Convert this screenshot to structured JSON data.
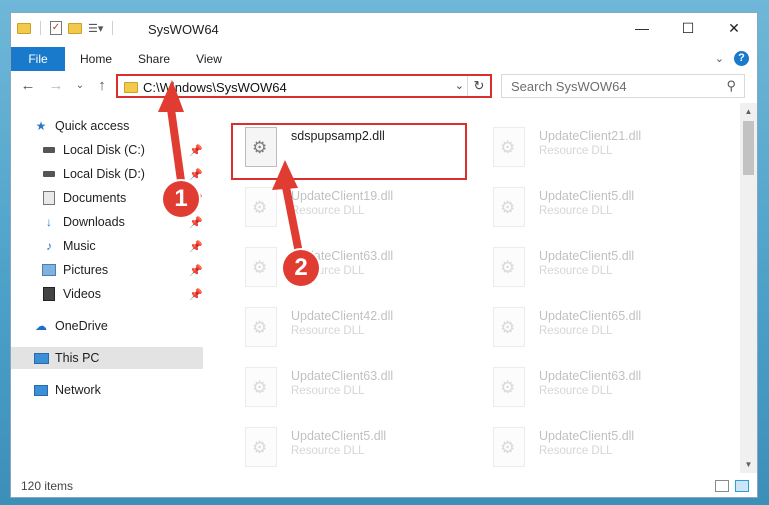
{
  "window": {
    "title": "SysWOW64",
    "controls": {
      "minimize": "—",
      "maximize": "☐",
      "close": "✕"
    }
  },
  "ribbon": {
    "tabs": [
      "File",
      "Home",
      "Share",
      "View"
    ],
    "help_glyph": "?"
  },
  "navigation": {
    "back_icon": "arrow-left-icon",
    "forward_icon": "arrow-right-icon",
    "up_icon": "arrow-up-icon",
    "address": "C:\\Windows\\SysWOW64",
    "search_placeholder": "Search SysWOW64"
  },
  "sidebar": {
    "items": [
      {
        "label": "Quick access",
        "icon": "star-icon",
        "pinned": false
      },
      {
        "label": "Local Disk (C:)",
        "icon": "drive-icon",
        "pinned": true
      },
      {
        "label": "Local Disk (D:)",
        "icon": "drive-icon",
        "pinned": true
      },
      {
        "label": "Documents",
        "icon": "documents-icon",
        "pinned": true
      },
      {
        "label": "Downloads",
        "icon": "download-icon",
        "pinned": true
      },
      {
        "label": "Music",
        "icon": "music-icon",
        "pinned": true
      },
      {
        "label": "Pictures",
        "icon": "pictures-icon",
        "pinned": true
      },
      {
        "label": "Videos",
        "icon": "videos-icon",
        "pinned": true
      },
      {
        "label": "OneDrive",
        "icon": "cloud-icon",
        "pinned": false
      },
      {
        "label": "This PC",
        "icon": "computer-icon",
        "pinned": false,
        "selected": true
      },
      {
        "label": "Network",
        "icon": "network-icon",
        "pinned": false
      }
    ]
  },
  "files": {
    "highlighted": {
      "name": "sdspupsamp2.dll",
      "type": ""
    },
    "left_column": [
      {
        "name": "UpdateClient19.dll",
        "type": "Resource DLL"
      },
      {
        "name": "UpdateClient63.dll",
        "type": "Resource DLL"
      },
      {
        "name": "UpdateClient42.dll",
        "type": "Resource DLL"
      },
      {
        "name": "UpdateClient63.dll",
        "type": "Resource DLL"
      },
      {
        "name": "UpdateClient5.dll",
        "type": "Resource DLL"
      }
    ],
    "right_column": [
      {
        "name": "UpdateClient21.dll",
        "type": "Resource DLL"
      },
      {
        "name": "UpdateClient5.dll",
        "type": "Resource DLL"
      },
      {
        "name": "UpdateClient5.dll",
        "type": "Resource DLL"
      },
      {
        "name": "UpdateClient65.dll",
        "type": "Resource DLL"
      },
      {
        "name": "UpdateClient63.dll",
        "type": "Resource DLL"
      },
      {
        "name": "UpdateClient5.dll",
        "type": "Resource DLL"
      }
    ]
  },
  "status": {
    "item_count": "120 items"
  },
  "annotations": {
    "step1": "1",
    "step2": "2",
    "color": "#e03c31"
  }
}
